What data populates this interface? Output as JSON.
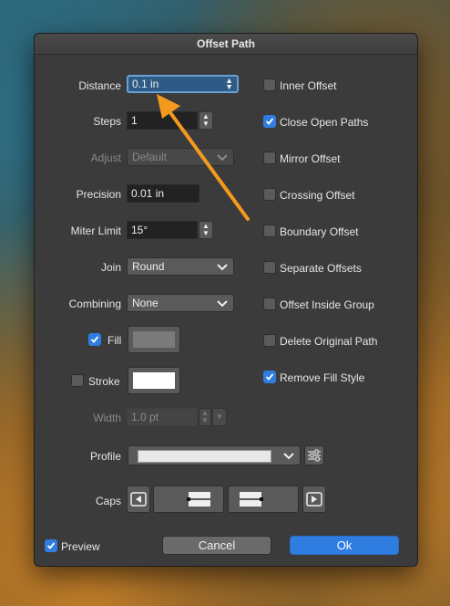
{
  "dialog": {
    "title": "Offset Path",
    "distance": {
      "label": "Distance",
      "value": "0.1 in"
    },
    "steps": {
      "label": "Steps",
      "value": "1"
    },
    "adjust": {
      "label": "Adjust",
      "value": "Default"
    },
    "precision": {
      "label": "Precision",
      "value": "0.01 in"
    },
    "miter_limit": {
      "label": "Miter Limit",
      "value": "15°"
    },
    "join": {
      "label": "Join",
      "value": "Round"
    },
    "combining": {
      "label": "Combining",
      "value": "None"
    },
    "fill": {
      "label": "Fill",
      "checked": true,
      "color": "#7a7a7a"
    },
    "stroke": {
      "label": "Stroke",
      "checked": false,
      "color": "#ffffff"
    },
    "width": {
      "label": "Width",
      "value": "1.0 pt"
    },
    "profile": {
      "label": "Profile"
    },
    "caps": {
      "label": "Caps"
    },
    "options": [
      {
        "label": "Inner Offset",
        "checked": false
      },
      {
        "label": "Close Open Paths",
        "checked": true
      },
      {
        "label": "Mirror Offset",
        "checked": false
      },
      {
        "label": "Crossing Offset",
        "checked": false
      },
      {
        "label": "Boundary Offset",
        "checked": false
      },
      {
        "label": "Separate Offsets",
        "checked": false
      },
      {
        "label": "Offset Inside Group",
        "checked": false
      },
      {
        "label": "Delete Original Path",
        "checked": false
      },
      {
        "label": "Remove Fill Style",
        "checked": true
      }
    ],
    "preview": {
      "label": "Preview",
      "checked": true
    },
    "cancel_label": "Cancel",
    "ok_label": "Ok"
  },
  "colors": {
    "accent": "#2f7de1",
    "annotation_arrow": "#f39a1e"
  }
}
